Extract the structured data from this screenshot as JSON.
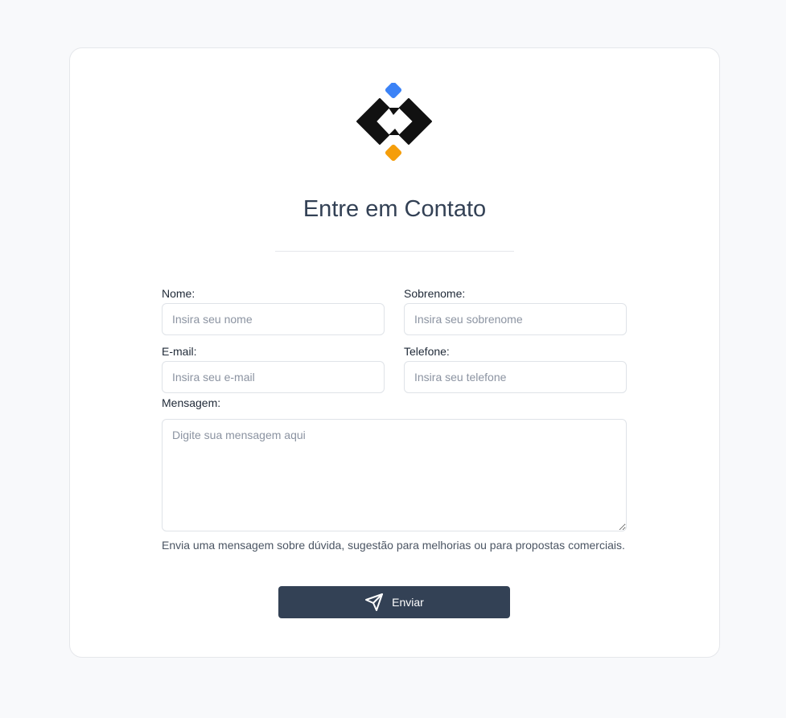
{
  "page": {
    "title": "Entre em Contato",
    "logo_icon": "brand-logo-icon"
  },
  "form": {
    "first_name": {
      "label": "Nome:",
      "placeholder": "Insira seu nome",
      "value": ""
    },
    "last_name": {
      "label": "Sobrenome:",
      "placeholder": "Insira seu sobrenome",
      "value": ""
    },
    "email": {
      "label": "E-mail:",
      "placeholder": "Insira seu e-mail",
      "value": ""
    },
    "phone": {
      "label": "Telefone:",
      "placeholder": "Insira seu telefone",
      "value": ""
    },
    "message": {
      "label": "Mensagem:",
      "placeholder": "Digite sua mensagem aqui",
      "value": ""
    },
    "hint": "Envia uma mensagem sobre dúvida, sugestão para melhorias ou para propostas comerciais.",
    "submit_label": "Enviar",
    "submit_icon": "send-icon"
  },
  "colors": {
    "background": "#f8f9fb",
    "button": "#334155",
    "logo_dark": "#111111",
    "logo_blue": "#3b82f6",
    "logo_orange": "#f59e0b"
  }
}
